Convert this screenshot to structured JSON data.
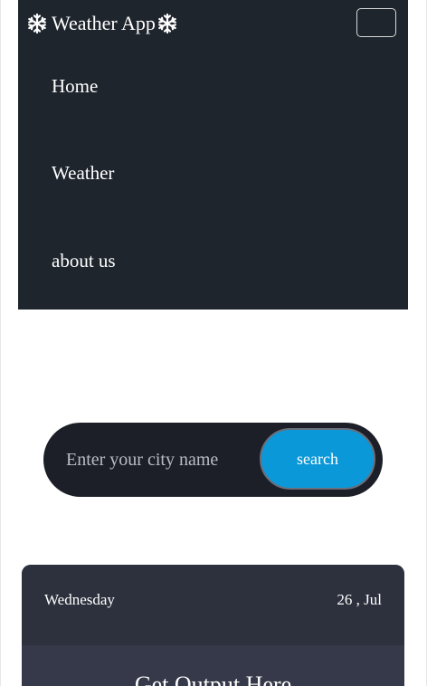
{
  "navbar": {
    "brand": "Weather App",
    "brand_icon": "snowflake-icon",
    "toggler_icon": "hamburger-menu-icon",
    "items": [
      {
        "label": "Home"
      },
      {
        "label": "Weather"
      },
      {
        "label": "about us"
      }
    ]
  },
  "search": {
    "placeholder": "Enter your city name",
    "value": "",
    "button_label": "search"
  },
  "card": {
    "day": "Wednesday",
    "date": "26 , Jul",
    "output": "Get Output Here"
  },
  "colors": {
    "navbar_bg": "#1f252d",
    "search_bg": "#1c1f28",
    "accent": "#0a98d8",
    "card_head_bg": "#2d313d",
    "card_body_bg": "#363949"
  }
}
